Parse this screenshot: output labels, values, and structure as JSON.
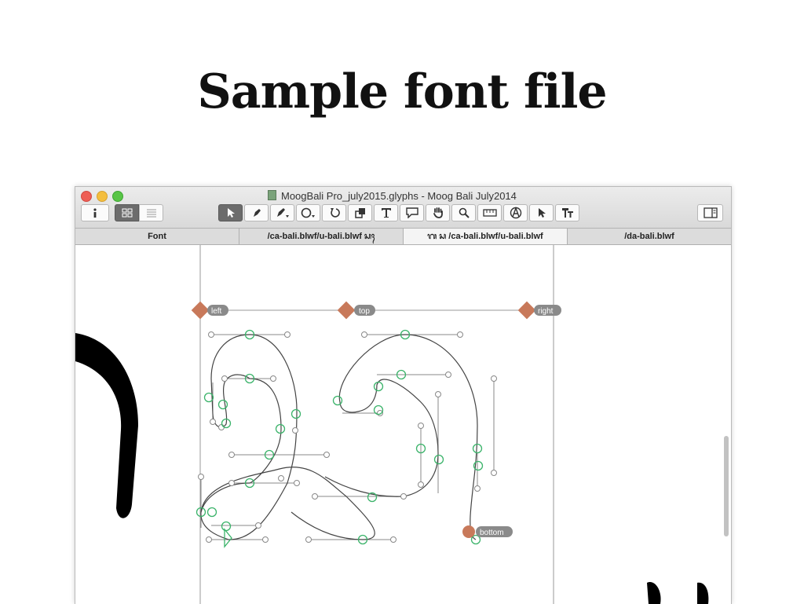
{
  "slide": {
    "title": "Sample font file"
  },
  "window": {
    "title": "MoogBali Pro_july2015.glyphs - Moog Bali July2014",
    "doc_icon": "glyphs-document-icon"
  },
  "toolbar": {
    "tools": [
      "info-icon",
      "grid-view-icon",
      "list-view-icon",
      "select-tool-icon",
      "draw-tool-icon",
      "pen-tool-icon",
      "ellipse-tool-icon",
      "rotate-tool-icon",
      "scale-tool-icon",
      "text-tool-icon",
      "annotation-tool-icon",
      "hand-tool-icon",
      "zoom-tool-icon",
      "measure-tool-icon",
      "anchor-tool-icon",
      "pointer-tool-icon",
      "type-tool-icon",
      "sidebar-toggle-icon"
    ]
  },
  "tabs": [
    {
      "label": "Font"
    },
    {
      "label": "/ca-bali.blwf⁩/u-bali.blwf  ᬲᬄ"
    },
    {
      "label": "ᬕ ᬲ /ca-bali.blwf/u-bali.blwf"
    },
    {
      "label": "/da-bali.blwf"
    }
  ],
  "anchors": {
    "left": "left",
    "top": "top",
    "right": "right",
    "bottom": "bottom"
  },
  "colors": {
    "anchor": "#c8795a",
    "on_curve": "#3bb36a",
    "outline": "#444444",
    "handle": "#888888"
  }
}
